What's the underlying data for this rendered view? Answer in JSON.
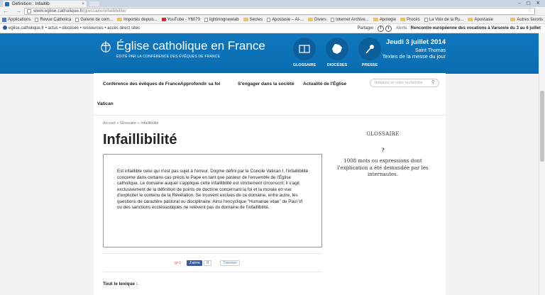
{
  "browser": {
    "tab_title": "Définition : Infaillib",
    "tab_close": "×",
    "window_controls": "– ▢ ✕",
    "nav_glyphs": "← → C",
    "url_host": "www.eglise.catholique.fr",
    "url_path": "/glossaire/infaillibilite/",
    "star": "☆",
    "menu": "≡"
  },
  "bookmarks": {
    "items": [
      {
        "label": "Applications",
        "icon": "apps-icon"
      },
      {
        "label": "Revue Catholica",
        "icon": "page-icon"
      },
      {
        "label": "Galerie de com...",
        "icon": "page-icon"
      },
      {
        "label": "Importés depuis...",
        "icon": "folder-icon"
      },
      {
        "label": "YouTube - Y6070",
        "icon": "youtube-icon"
      },
      {
        "label": "lightningnewtab",
        "icon": "page-icon"
      },
      {
        "label": "Sectes",
        "icon": "folder-icon"
      },
      {
        "label": "Apostasie – Al-...",
        "icon": "page-icon"
      },
      {
        "label": "Divers",
        "icon": "folder-icon"
      },
      {
        "label": "Internet Archive...",
        "icon": "page-icon"
      },
      {
        "label": "Apologie",
        "icon": "folder-icon"
      },
      {
        "label": "Procès",
        "icon": "folder-icon"
      },
      {
        "label": "La Voix de la Ru...",
        "icon": "page-icon"
      },
      {
        "label": "Apostasie",
        "icon": "folder-icon"
      }
    ],
    "other": "Autres favoris"
  },
  "strip": {
    "left": "eglise.catholique.fr  • actus  • diocèses  • ressources  • accès direct sites",
    "share_label": "Partager :",
    "alert_label": "Alerte : ",
    "alert_text": "Rencontre européenne des vocations à Varsovie du 3 au 6 juillet"
  },
  "header": {
    "title": "Église catholique en France",
    "subtitle": "ÉDITÉ PAR LA CONFÉRENCE DES ÉVÊQUES DE FRANCE",
    "icons": [
      {
        "label": "GLOSSAIRE",
        "icon": "book-icon"
      },
      {
        "label": "DIOCÈSES",
        "icon": "france-map-icon"
      },
      {
        "label": "PRESSE",
        "icon": "microphone-icon"
      }
    ],
    "date": "Jeudi 3 juillet 2014",
    "saint": "Saint Thomas",
    "texts_link": "Textes de la messe du jour"
  },
  "nav": {
    "items": [
      "Conférence des évêques de France",
      "Approfondir sa foi",
      "S'engager dans la société",
      "Actualité de l'Église",
      "Vatican"
    ],
    "search_placeholder": "Indiquez ici votre recherche"
  },
  "page": {
    "breadcrumb": "Accueil » Glossaire » Infaillibilité",
    "title": "Infaillibilité",
    "definition": "Est infaillible celui qui n'est pas sujet à l'erreur. Dogme défini par le Concile Vatican I, l'infaillibilité concerne dans certains cas précis le Pape en tant que pasteur de l'ensemble de l'Église catholique. Le domaine auquel s'applique cette infaillibilité est strictement circonscrit; il s'agit exclusivement de la définition de points de doctrine concernant la foi et la morale en vue d'expliciter le contenu de la Révélation. Se trouvent exclues de ce domaine, entre autre, les questions de caractère pastoral ou disciplinaire. Ainsi l'encyclique \"Humanae vitae\" de Paul VI ou des sanctions ecclésiastiques ne relèvent pas du domaine de l'infaillibilité.",
    "share": {
      "gplus": "g+1",
      "like": "J'aime",
      "like_count": "0",
      "tweet": "Tweeter"
    },
    "lexique": "Tout le lexique :"
  },
  "sidebar": {
    "heading": "GLOSSAIRE",
    "question": "?",
    "count_text": "1008 mots ou expressions dont l'explication a été demandée par les internautes."
  },
  "colors": {
    "brand_blue": "#0b73b9",
    "icon_circle": "#0d5f9b"
  }
}
